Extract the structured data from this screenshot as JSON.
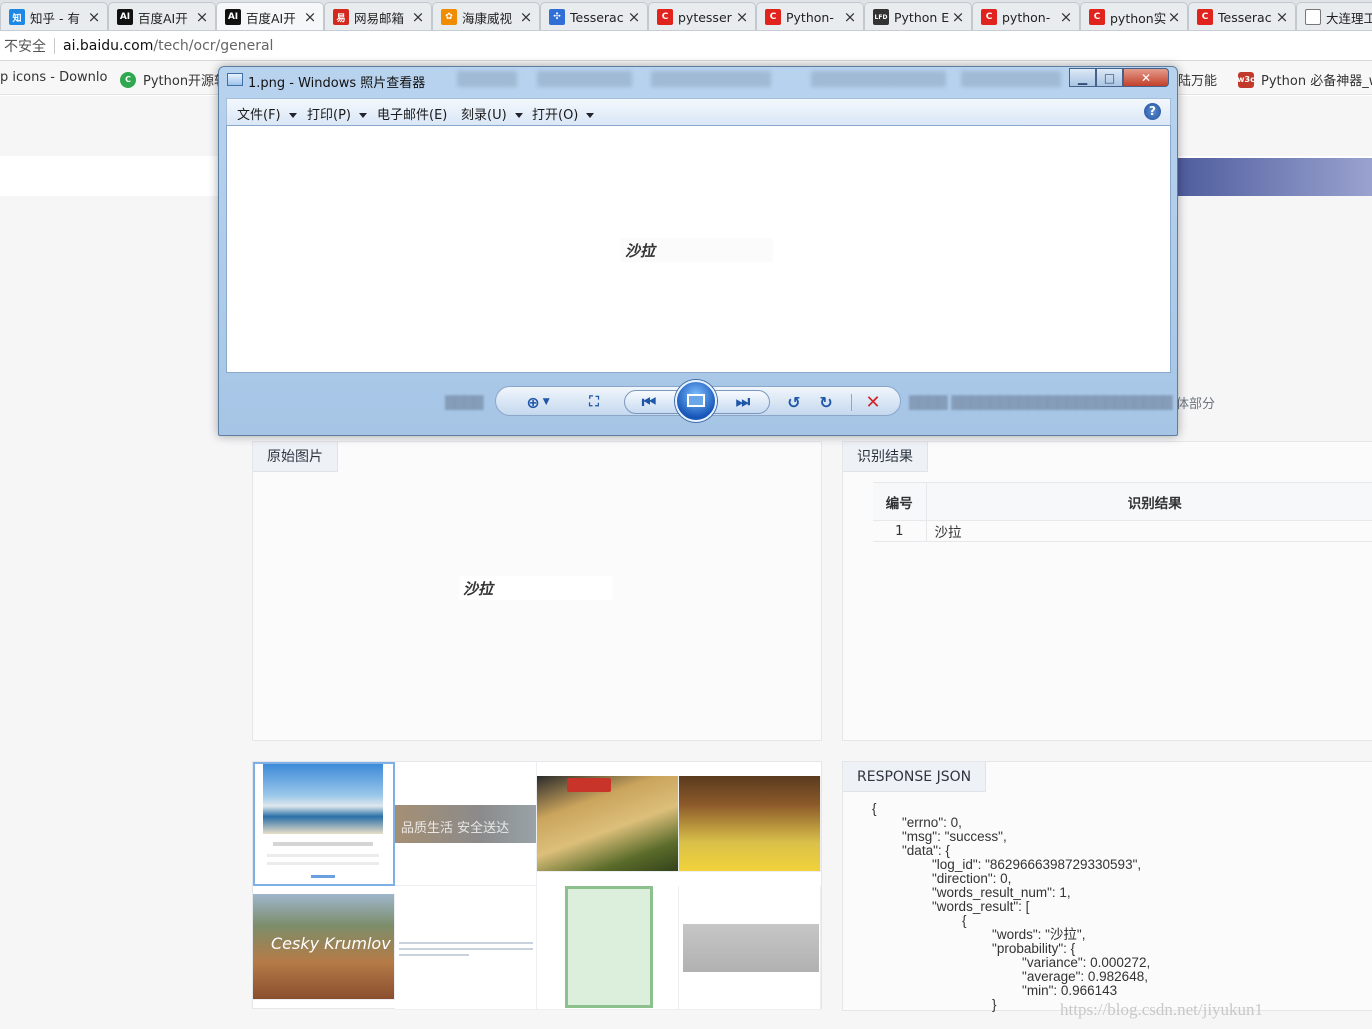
{
  "tabs": [
    {
      "label": "知乎 - 有",
      "icon": "zhihu-icon",
      "fav_text": "知",
      "color": "#1e88e5"
    },
    {
      "label": "百度AI开",
      "icon": "baidu-ai-icon",
      "fav_text": "AI",
      "color": "#111111"
    },
    {
      "label": "百度AI开",
      "icon": "baidu-ai-icon",
      "fav_text": "AI",
      "color": "#111111",
      "active": true
    },
    {
      "label": "网易邮箱",
      "icon": "netease-mail-icon",
      "fav_text": "易",
      "color": "#d4281e"
    },
    {
      "label": "海康威视",
      "icon": "hikvision-icon",
      "fav_text": "✿",
      "color": "#f08c00"
    },
    {
      "label": "Tesserac",
      "icon": "baidu-paw-icon",
      "fav_text": "✣",
      "color": "#2f6fd6"
    },
    {
      "label": "pytesser",
      "icon": "csdn-icon",
      "fav_text": "C",
      "color": "#e0231c"
    },
    {
      "label": "Python-",
      "icon": "csdn-icon",
      "fav_text": "C",
      "color": "#e0231c"
    },
    {
      "label": "Python E",
      "icon": "lfd-icon",
      "fav_text": "LFD",
      "color": "#333333"
    },
    {
      "label": "python-",
      "icon": "csdn-icon",
      "fav_text": "C",
      "color": "#e0231c"
    },
    {
      "label": "python实",
      "icon": "csdn-icon",
      "fav_text": "C",
      "color": "#e0231c"
    },
    {
      "label": "Tesserac",
      "icon": "csdn-icon",
      "fav_text": "C",
      "color": "#e0231c"
    },
    {
      "label": "大连理工",
      "icon": "page-icon",
      "fav_text": "",
      "color": "#ffffff"
    }
  ],
  "address": {
    "security": "不安全",
    "host": "ai.baidu.com",
    "path": "/tech/ocr/general"
  },
  "bookmarks": [
    {
      "label": "p icons - Downlo"
    },
    {
      "label": "Python开源软",
      "icon": "python-bookmark-icon"
    },
    {
      "label": "陆万能"
    },
    {
      "label": "Python 必备神器_w",
      "icon": "w3c-icon"
    }
  ],
  "viewer": {
    "title": "1.png - Windows 照片查看器",
    "menu": [
      "文件(F)",
      "打印(P)",
      "电子邮件(E)",
      "刻录(U)",
      "打开(O)"
    ],
    "menu_has_dropdown": [
      true,
      true,
      false,
      true,
      true
    ],
    "help": "?",
    "image_word": "沙拉"
  },
  "page": {
    "desc_tail": "体部分",
    "original_tab": "原始图片",
    "original_word": "沙拉",
    "result_tab": "识别结果",
    "table": {
      "headers": [
        "编号",
        "识别结果"
      ],
      "rows": [
        {
          "num": "1",
          "text": "沙拉"
        }
      ]
    },
    "thumb_captions": [
      "品质生活 安全送达",
      "Cesky Krumlov"
    ],
    "json_tab": "RESPONSE JSON",
    "json_text": "{\n        \"errno\": 0,\n        \"msg\": \"success\",\n        \"data\": {\n                \"log_id\": \"8629666398729330593\",\n                \"direction\": 0,\n                \"words_result_num\": 1,\n                \"words_result\": [\n                        {\n                                \"words\": \"沙拉\",\n                                \"probability\": {\n                                        \"variance\": 0.000272,\n                                        \"average\": 0.982648,\n                                        \"min\": 0.966143\n                                }"
  },
  "watermark": "https://blog.csdn.net/jiyukun1"
}
